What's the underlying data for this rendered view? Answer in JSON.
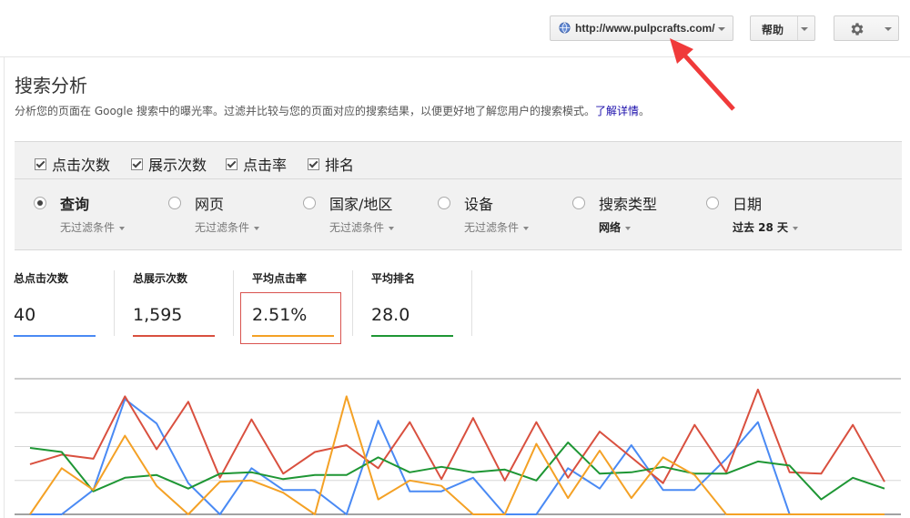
{
  "header": {
    "site_url": "http://www.pulpcrafts.com/",
    "help_label": "帮助"
  },
  "page": {
    "title": "搜索分析",
    "description": "分析您的页面在 Google 搜索中的曝光率。过滤并比较与您的页面对应的搜索结果，以便更好地了解您用户的搜索模式。",
    "learn_more": "了解详情",
    "period": "。"
  },
  "checkboxes": [
    {
      "label": "点击次数",
      "checked": true
    },
    {
      "label": "展示次数",
      "checked": true
    },
    {
      "label": "点击率",
      "checked": true
    },
    {
      "label": "排名",
      "checked": true
    }
  ],
  "dimensions": [
    {
      "label": "查询",
      "sub": "无过滤条件",
      "selected": true
    },
    {
      "label": "网页",
      "sub": "无过滤条件",
      "selected": false
    },
    {
      "label": "国家/地区",
      "sub": "无过滤条件",
      "selected": false
    },
    {
      "label": "设备",
      "sub": "无过滤条件",
      "selected": false
    },
    {
      "label": "搜索类型",
      "sub": "网络",
      "selected": false
    },
    {
      "label": "日期",
      "sub": "过去 28 天",
      "selected": false
    }
  ],
  "metrics": [
    {
      "label": "总点击次数",
      "value": "40",
      "color": "#4a8af4"
    },
    {
      "label": "总展示次数",
      "value": "1,595",
      "color": "#d9503f"
    },
    {
      "label": "平均点击率",
      "value": "2.51%",
      "color": "#f4a125"
    },
    {
      "label": "平均排名",
      "value": "28.0",
      "color": "#1e9634"
    }
  ],
  "chart_data": {
    "type": "line",
    "title": "",
    "xlabel": "",
    "ylabel": "",
    "grid": true,
    "legend": "none",
    "ylim": [
      0,
      1
    ],
    "x": [
      1,
      2,
      3,
      4,
      5,
      6,
      7,
      8,
      9,
      10,
      11,
      12,
      13,
      14,
      15,
      16,
      17,
      18,
      19,
      20,
      21,
      22,
      23,
      24,
      25,
      26,
      27,
      28
    ],
    "series": [
      {
        "color": "#4a8af4",
        "values": [
          0.0,
          0.0,
          0.18,
          0.85,
          0.67,
          0.23,
          0.0,
          0.34,
          0.18,
          0.18,
          0.0,
          0.69,
          0.17,
          0.17,
          0.27,
          0.0,
          0.0,
          0.34,
          0.19,
          0.51,
          0.18,
          0.18,
          0.41,
          0.68,
          0.0,
          0.0,
          0.0,
          0.0
        ]
      },
      {
        "color": "#d9503f",
        "values": [
          0.37,
          0.44,
          0.41,
          0.87,
          0.48,
          0.83,
          0.27,
          0.7,
          0.3,
          0.46,
          0.51,
          0.34,
          0.68,
          0.26,
          0.71,
          0.25,
          0.68,
          0.27,
          0.61,
          0.42,
          0.23,
          0.66,
          0.31,
          0.92,
          0.31,
          0.3,
          0.66,
          0.24
        ]
      },
      {
        "color": "#1e9634",
        "values": [
          0.49,
          0.46,
          0.17,
          0.27,
          0.29,
          0.19,
          0.3,
          0.31,
          0.26,
          0.29,
          0.29,
          0.42,
          0.31,
          0.35,
          0.31,
          0.33,
          0.25,
          0.53,
          0.3,
          0.31,
          0.35,
          0.3,
          0.3,
          0.39,
          0.36,
          0.11,
          0.27,
          0.19
        ]
      },
      {
        "color": "#f4a125",
        "values": [
          0.0,
          0.34,
          0.18,
          0.58,
          0.21,
          0.0,
          0.24,
          0.25,
          0.16,
          0.0,
          0.87,
          0.11,
          0.25,
          0.21,
          0.0,
          0.0,
          0.52,
          0.12,
          0.47,
          0.12,
          0.42,
          0.29,
          0.0,
          0.0,
          0.0,
          0.0,
          0.0,
          0.0
        ]
      }
    ]
  }
}
